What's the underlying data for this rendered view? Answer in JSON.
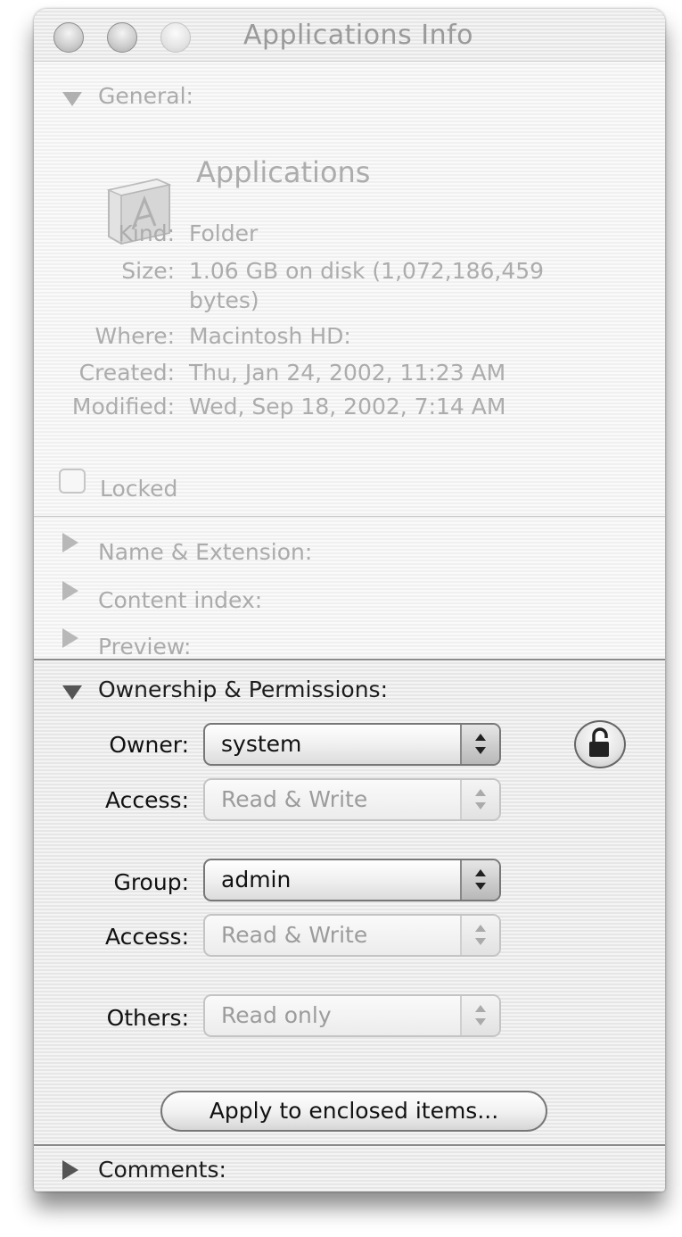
{
  "window": {
    "title": "Applications Info"
  },
  "general": {
    "section_label": "General:",
    "item_name": "Applications",
    "kind_label": "Kind:",
    "kind_value": "Folder",
    "size_label": "Size:",
    "size_value_line1": "1.06 GB on disk (1,072,186,459",
    "size_value_line2": "bytes)",
    "where_label": "Where:",
    "where_value": "Macintosh HD:",
    "created_label": "Created:",
    "created_value": "Thu, Jan 24, 2002, 11:23 AM",
    "modified_label": "Modified:",
    "modified_value": "Wed, Sep 18, 2002, 7:14 AM",
    "locked_label": "Locked",
    "locked_checked": false
  },
  "sections": {
    "name_extension": "Name & Extension:",
    "content_index": "Content index:",
    "preview": "Preview:",
    "ownership": "Ownership & Permissions:",
    "comments": "Comments:"
  },
  "permissions": {
    "owner_label": "Owner:",
    "owner_value": "system",
    "owner_access_label": "Access:",
    "owner_access_value": "Read & Write",
    "group_label": "Group:",
    "group_value": "admin",
    "group_access_label": "Access:",
    "group_access_value": "Read & Write",
    "others_label": "Others:",
    "others_value": "Read only",
    "apply_button": "Apply to enclosed items...",
    "lock_state": "unlocked"
  },
  "icons": {
    "window_controls": [
      "close",
      "minimize",
      "zoom"
    ],
    "folder": "applications-folder-icon",
    "lock": "padlock-icon"
  }
}
